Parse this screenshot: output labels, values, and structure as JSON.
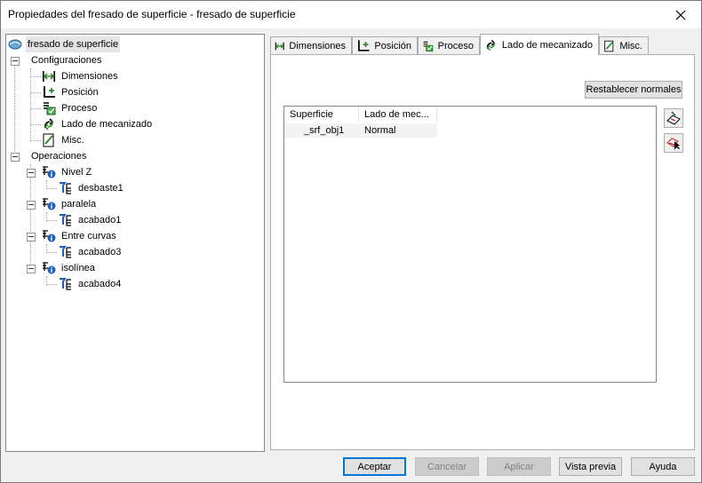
{
  "window": {
    "title": "Propiedades del fresado de superficie - fresado de superficie",
    "close_icon": "close-icon"
  },
  "tree": {
    "root": "fresado de superficie",
    "config": {
      "label": "Configuraciones",
      "items": [
        "Dimensiones",
        "Posición",
        "Proceso",
        "Lado de mecanizado",
        "Misc."
      ]
    },
    "operations": {
      "label": "Operaciones",
      "groups": [
        {
          "label": "Nivel Z",
          "child": "desbaste1"
        },
        {
          "label": "paralela",
          "child": "acabado1"
        },
        {
          "label": "Entre curvas",
          "child": "acabado3"
        },
        {
          "label": "isolínea",
          "child": "acabado4"
        }
      ]
    }
  },
  "tabs": [
    "Dimensiones",
    "Posición",
    "Proceso",
    "Lado de mecanizado",
    "Misc."
  ],
  "active_tab": "Lado de mecanizado",
  "panel": {
    "reset_button": "Restablecer normales",
    "columns": [
      "Superficie",
      "Lado de mec..."
    ],
    "rows": [
      {
        "surface": "_srf_obj1",
        "side": "Normal"
      }
    ]
  },
  "footer": {
    "accept": "Aceptar",
    "cancel": "Cancelar",
    "apply": "Aplicar",
    "preview": "Vista previa",
    "help": "Ayuda"
  },
  "colors": {
    "accent": "#0078d7",
    "selection": "#e5e5e5",
    "icon_green": "#2e8b2e",
    "icon_blue": "#1e5fbf"
  }
}
